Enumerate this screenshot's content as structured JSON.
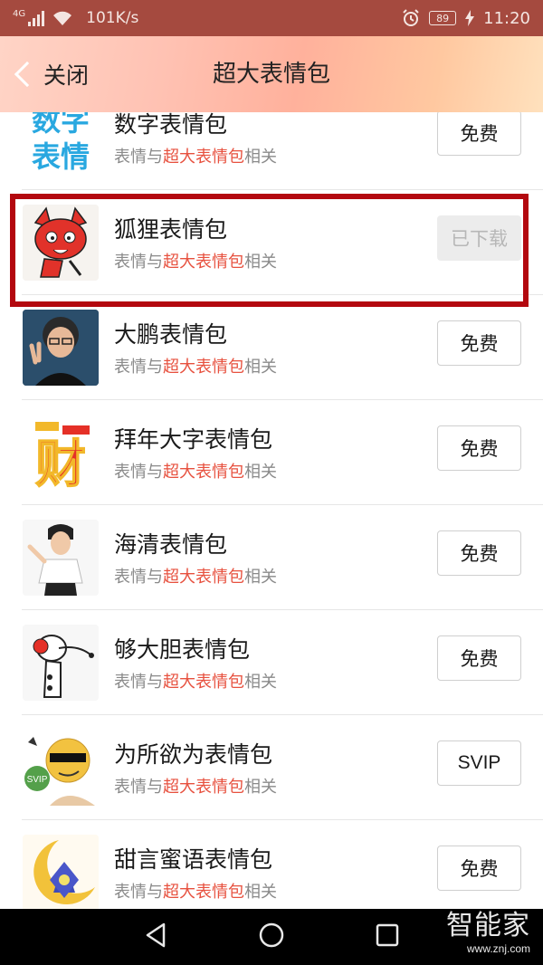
{
  "status_bar": {
    "network": "4G",
    "speed": "101K/s",
    "battery": "89",
    "time": "11:20",
    "icons": [
      "signal-icon",
      "wifi-icon",
      "alarm-icon",
      "battery-icon",
      "charging-icon"
    ]
  },
  "header": {
    "back_label": "关闭",
    "title": "超大表情包"
  },
  "list": {
    "items": [
      {
        "name": "数字表情包",
        "desc_prefix": "表情与",
        "desc_highlight": "超大表情包",
        "desc_suffix": "相关",
        "button": "免费",
        "thumb_text": "数字表情"
      },
      {
        "name": "狐狸表情包",
        "desc_prefix": "表情与",
        "desc_highlight": "超大表情包",
        "desc_suffix": "相关",
        "button": "已下载"
      },
      {
        "name": "大鹏表情包",
        "desc_prefix": "表情与",
        "desc_highlight": "超大表情包",
        "desc_suffix": "相关",
        "button": "免费"
      },
      {
        "name": "拜年大字表情包",
        "desc_prefix": "表情与",
        "desc_highlight": "超大表情包",
        "desc_suffix": "相关",
        "button": "免费",
        "thumb_text": "财"
      },
      {
        "name": "海清表情包",
        "desc_prefix": "表情与",
        "desc_highlight": "超大表情包",
        "desc_suffix": "相关",
        "button": "免费"
      },
      {
        "name": "够大胆表情包",
        "desc_prefix": "表情与",
        "desc_highlight": "超大表情包",
        "desc_suffix": "相关",
        "button": "免费"
      },
      {
        "name": "为所欲为表情包",
        "desc_prefix": "表情与",
        "desc_highlight": "超大表情包",
        "desc_suffix": "相关",
        "button": "SVIP",
        "thumb_text": "SVIP"
      },
      {
        "name": "甜言蜜语表情包",
        "desc_prefix": "表情与",
        "desc_highlight": "超大表情包",
        "desc_suffix": "相关",
        "button": "免费"
      }
    ]
  },
  "watermark": {
    "big": "智能家",
    "small": "www.znj.com"
  },
  "colors": {
    "status_bar": "#a54a3f",
    "highlight_text": "#e7513f",
    "highlight_box": "#b3080f"
  }
}
